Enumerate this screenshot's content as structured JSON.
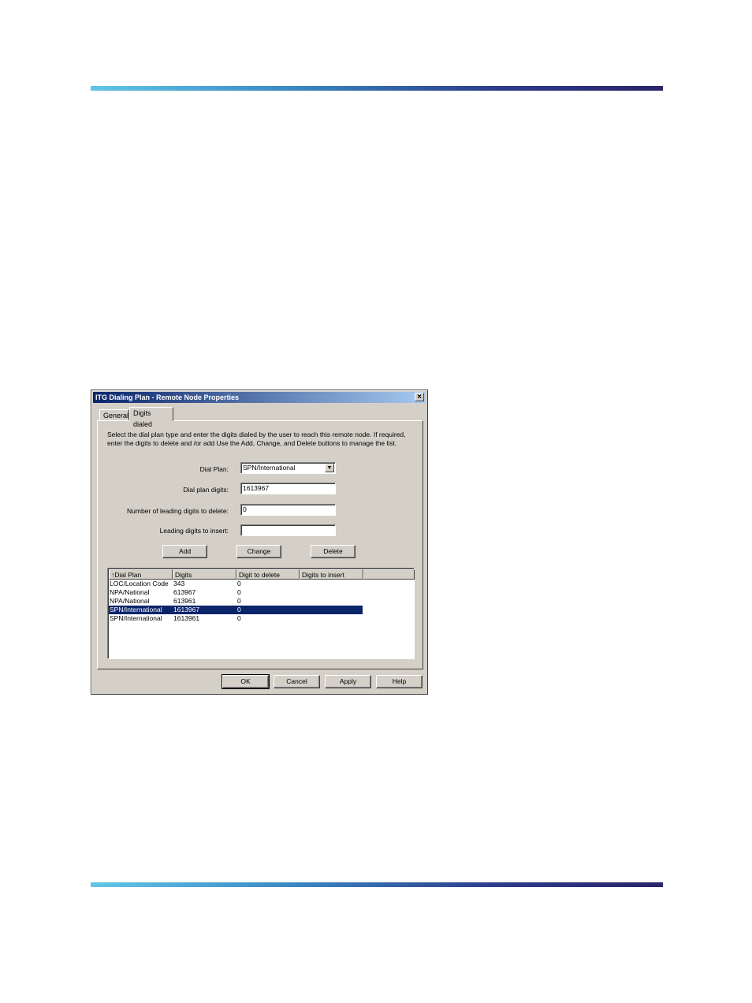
{
  "dialog": {
    "title": "ITG Dialing Plan - Remote Node Properties",
    "close_glyph": "×",
    "tabs": [
      {
        "label": "General"
      },
      {
        "label": "Digits dialed"
      }
    ],
    "intro_text": "Select the dial plan type and enter the digits dialed by the user to reach this remote node. If required, enter the digits to delete and /or add Use the Add, Change, and Delete buttons to manage the list.",
    "fields": {
      "dial_plan": {
        "label": "Dial Plan:",
        "value": "SPN/International"
      },
      "dial_plan_digits": {
        "label": "Dial plan digits:",
        "value": "1613967"
      },
      "leading_delete": {
        "label": "Number of leading digits to delete:",
        "value": "0"
      },
      "leading_insert": {
        "label": "Leading digits to insert:",
        "value": ""
      }
    },
    "list_buttons": {
      "add": "Add",
      "change": "Change",
      "delete": "Delete"
    },
    "list": {
      "columns": [
        "↑Dial Plan",
        "Digits",
        "Digit to delete",
        "Digits to insert"
      ],
      "rows": [
        {
          "plan": "LOC/Location Code",
          "digits": "343",
          "delete": "0",
          "insert": ""
        },
        {
          "plan": "NPA/National",
          "digits": "613967",
          "delete": "0",
          "insert": ""
        },
        {
          "plan": "NPA/National",
          "digits": "613961",
          "delete": "0",
          "insert": ""
        },
        {
          "plan": "SPN/International",
          "digits": "1613967",
          "delete": "0",
          "insert": "",
          "selected": true
        },
        {
          "plan": "SPN/International",
          "digits": "1613961",
          "delete": "0",
          "insert": ""
        }
      ]
    },
    "footer_buttons": {
      "ok": "OK",
      "cancel": "Cancel",
      "apply": "Apply",
      "help": "Help"
    }
  },
  "colors": {
    "titlebar": "#0a246a",
    "dialog_bg": "#d4d0c8",
    "selection": "#0a246a"
  }
}
